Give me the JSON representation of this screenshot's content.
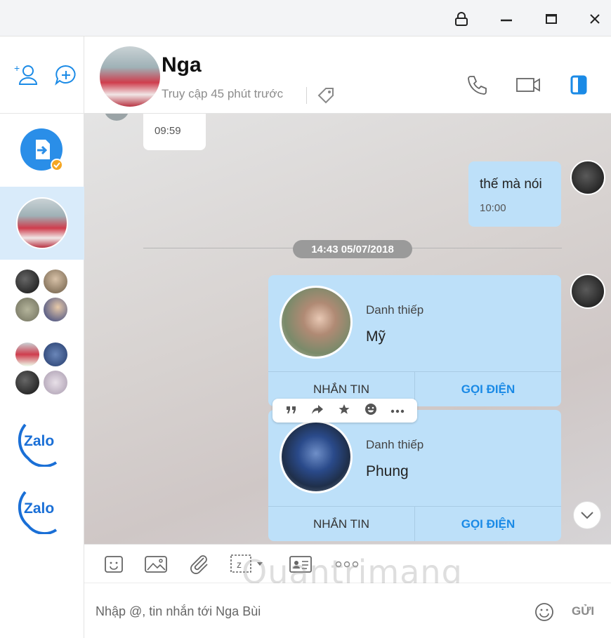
{
  "window": {
    "icons": [
      "lock-icon",
      "minimize-icon",
      "maximize-icon",
      "close-icon"
    ]
  },
  "header": {
    "name": "Nga",
    "status": "Truy cập 45 phút trước"
  },
  "messages": {
    "m1_time": "09:59",
    "m2_text": "thế mà nói",
    "m2_time": "10:00",
    "date_separator": "14:43 05/07/2018"
  },
  "cards": [
    {
      "label": "Danh thiếp",
      "name": "Mỹ",
      "message_btn": "NHẮN TIN",
      "call_btn": "GỌI ĐIỆN"
    },
    {
      "label": "Danh thiếp",
      "name": "Phung",
      "message_btn": "NHẮN TIN",
      "call_btn": "GỌI ĐIỆN"
    }
  ],
  "sidebar": {
    "zalo_label": "Zalo"
  },
  "composer": {
    "placeholder": "Nhập @, tin nhắn tới Nga Bùi",
    "send_label": "GỬI"
  },
  "watermark": "Quantrimang",
  "colors": {
    "accent": "#1a8ae6",
    "outgoing_bubble": "#bde0f9",
    "active_sidebar": "#d9ebfa"
  }
}
